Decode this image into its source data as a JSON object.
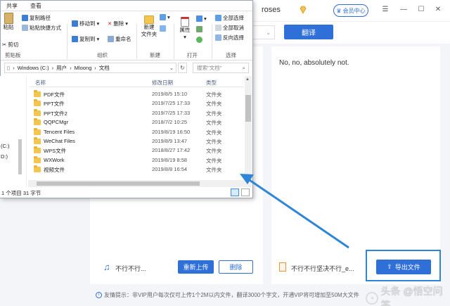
{
  "app": {
    "username": "roses",
    "vip_label": "会员中心",
    "translate_label": "翻译",
    "result_text": "No, no, absolutely not.",
    "left_file_name": "不行不行...",
    "reupload_label": "重新上传",
    "delete_label": "删除",
    "right_file_name": "不行不行坚决不行_e...",
    "export_label": "导出文件",
    "tip": "友情提示：非VIP用户每次仅可上传1个2M以内文件，翻译3000个字文，开通VIP将可增加至50M大文件",
    "watermark": "头条 @悟空问答",
    "accent_color": "#2f6fd8"
  },
  "explorer": {
    "tabs": [
      "共享",
      "查看"
    ],
    "ribbon": {
      "paste": "粘贴",
      "copy_path": "复制路径",
      "paste_shortcut": "粘贴快捷方式",
      "cut": "剪切",
      "clipboard_group": "剪贴板",
      "move_to": "移动到",
      "copy_to": "复制到",
      "delete": "删除",
      "rename": "重命名",
      "organize_group": "组织",
      "new_folder": "新建\n文件夹",
      "new_group": "新建",
      "properties": "属性",
      "open_group": "打开",
      "select_all": "全部选择",
      "select_none": "全部取消",
      "invert_selection": "反向选择",
      "select_group": "选择"
    },
    "breadcrumb": [
      "Windows (C:)",
      "用户",
      "Mloong",
      "文档"
    ],
    "search_placeholder": "搜索\"文档\"",
    "columns": {
      "name": "名称",
      "date": "修改日期",
      "type": "类型"
    },
    "nav_items": [
      "(C:)",
      "D:)"
    ],
    "rows": [
      {
        "name": "PDF文件",
        "date": "2019/8/5 15:10",
        "type": "文件夹"
      },
      {
        "name": "PPT文件",
        "date": "2019/7/25 17:33",
        "type": "文件夹"
      },
      {
        "name": "PPT文件2",
        "date": "2019/7/25 17:33",
        "type": "文件夹"
      },
      {
        "name": "QQPCMgr",
        "date": "2018/7/2 10:25",
        "type": "文件夹"
      },
      {
        "name": "Tencent Files",
        "date": "2019/8/19 16:50",
        "type": "文件夹"
      },
      {
        "name": "WeChat Files",
        "date": "2019/8/9 13:47",
        "type": "文件夹"
      },
      {
        "name": "WPS文件",
        "date": "2018/8/27 17:42",
        "type": "文件夹"
      },
      {
        "name": "WXWork",
        "date": "2019/8/19 8:58",
        "type": "文件夹"
      },
      {
        "name": "视频文件",
        "date": "2019/8/8 16:54",
        "type": "文件夹"
      }
    ],
    "status": "1 个项目    31 字节"
  }
}
